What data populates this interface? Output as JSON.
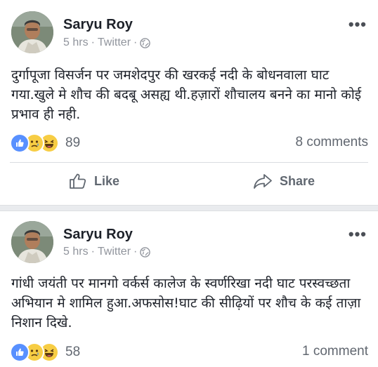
{
  "posts": [
    {
      "author": "Saryu Roy",
      "time": "5 hrs",
      "source": "Twitter",
      "text": "दुर्गापूजा विसर्जन पर जमशेदपुर की खरकई नदी के बोधनवाला घाट गया.खुले मे शौच की बदबू असह्य थी.हज़ारों शौचालय बनने का मानो कोई प्रभाव ही नही.",
      "reaction_count": "89",
      "comments": "8 comments",
      "actions": {
        "like": "Like",
        "share": "Share"
      }
    },
    {
      "author": "Saryu Roy",
      "time": "5 hrs",
      "source": "Twitter",
      "text": "गांधी जयंती पर मानगो वर्कर्स कालेज के स्वर्णरिखा नदी घाट परस्वच्छता अभियान मे शामिल हुआ.अफसोस!घाट की सीढ़ियों पर शौच के कई ताज़ा निशान दिखे.",
      "reaction_count": "58",
      "comments": "1 comment"
    }
  ],
  "icons": {
    "more": "more-options-icon",
    "globe": "globe-icon",
    "like_reaction": "like-reaction-icon",
    "sad_reaction": "sad-reaction-icon",
    "haha_reaction": "haha-reaction-icon",
    "thumb": "thumbs-up-icon",
    "share": "share-arrow-icon"
  },
  "colors": {
    "like_blue": "#5890ff",
    "emoji_yellow": "#f7cd44",
    "meta_gray": "#90949c"
  }
}
